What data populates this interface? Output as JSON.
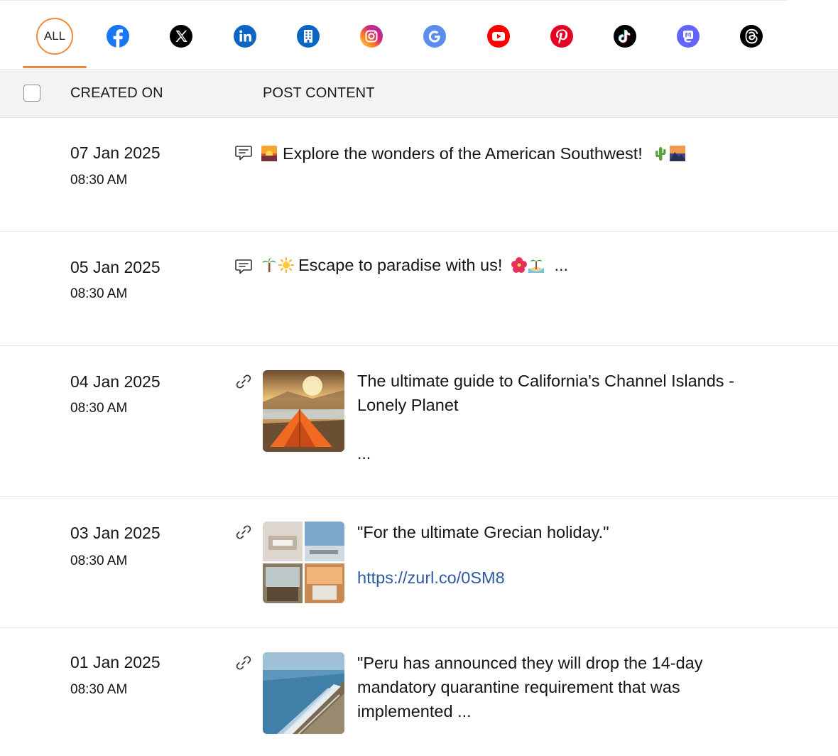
{
  "networks": {
    "all_label": "ALL",
    "items": [
      {
        "name": "facebook",
        "color": "#1877f2"
      },
      {
        "name": "x",
        "color": "#000000"
      },
      {
        "name": "linkedin",
        "color": "#0a66c2"
      },
      {
        "name": "linkedin-page",
        "color": "#0a66c2"
      },
      {
        "name": "instagram",
        "color": "#e1306c"
      },
      {
        "name": "google-business",
        "color": "#4285f4"
      },
      {
        "name": "youtube",
        "color": "#ff0000"
      },
      {
        "name": "pinterest",
        "color": "#e60023"
      },
      {
        "name": "tiktok",
        "color": "#000000"
      },
      {
        "name": "mastodon",
        "color": "#6364ff"
      },
      {
        "name": "threads",
        "color": "#000000"
      }
    ],
    "accent": "#ee8a3a"
  },
  "table": {
    "header": {
      "created_on": "CREATED ON",
      "post_content": "POST CONTENT"
    },
    "rows": [
      {
        "date": "07 Jan 2025",
        "time": "08:30 AM",
        "type": "text-post",
        "type_icon": "comment-icon",
        "text": "Explore the wonders of the American Southwest!",
        "emoji_before": [
          "sunset-emoji"
        ],
        "emoji_after": [
          "cactus-emoji",
          "mountain-sunset-emoji"
        ]
      },
      {
        "date": "05 Jan 2025",
        "time": "08:30 AM",
        "type": "text-post",
        "type_icon": "comment-icon",
        "text": "Escape to paradise with us!",
        "emoji_before": [
          "palm-tree-emoji",
          "sun-emoji"
        ],
        "emoji_after": [
          "hibiscus-emoji",
          "island-emoji"
        ],
        "suffix": "..."
      },
      {
        "date": "04 Jan 2025",
        "time": "08:30 AM",
        "type": "link-post",
        "type_icon": "link-icon",
        "thumbnail": "tent-at-sunset",
        "text": "The ultimate guide to California's Channel Islands - Lonely Planet",
        "more": "..."
      },
      {
        "date": "03 Jan 2025",
        "time": "08:30 AM",
        "type": "link-post",
        "type_icon": "link-icon",
        "thumbnail": "grecian-villa-collage",
        "text": "\"For the ultimate Grecian holiday.\"",
        "url": "https://zurl.co/0SM8",
        "link_color": "#2d59a3"
      },
      {
        "date": "01 Jan 2025",
        "time": "08:30 AM",
        "type": "link-post",
        "type_icon": "link-icon",
        "thumbnail": "peru-coastline",
        "text": "\"Peru has announced they will drop the 14-day mandatory quarantine requirement that was implemented ..."
      }
    ]
  }
}
